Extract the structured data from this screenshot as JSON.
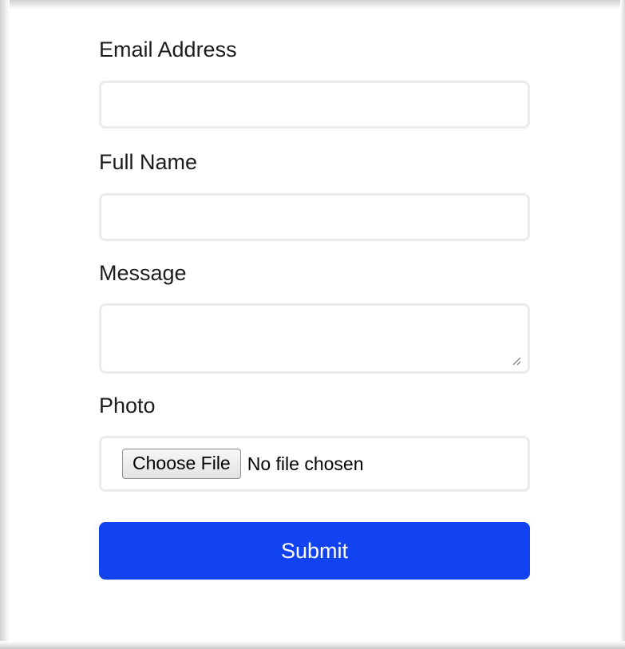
{
  "form": {
    "email": {
      "label": "Email Address",
      "value": "",
      "placeholder": ""
    },
    "full_name": {
      "label": "Full Name",
      "value": "",
      "placeholder": ""
    },
    "message": {
      "label": "Message",
      "value": ""
    },
    "photo": {
      "label": "Photo",
      "button_label": "Choose File",
      "status": "No file chosen"
    },
    "submit_label": "Submit"
  },
  "colors": {
    "submit_background": "#1243f0",
    "submit_text": "#ffffff",
    "field_border": "#ececec",
    "label_text": "#1c1c1c"
  },
  "icons": {
    "textarea_resize": "resize-grip-icon"
  }
}
